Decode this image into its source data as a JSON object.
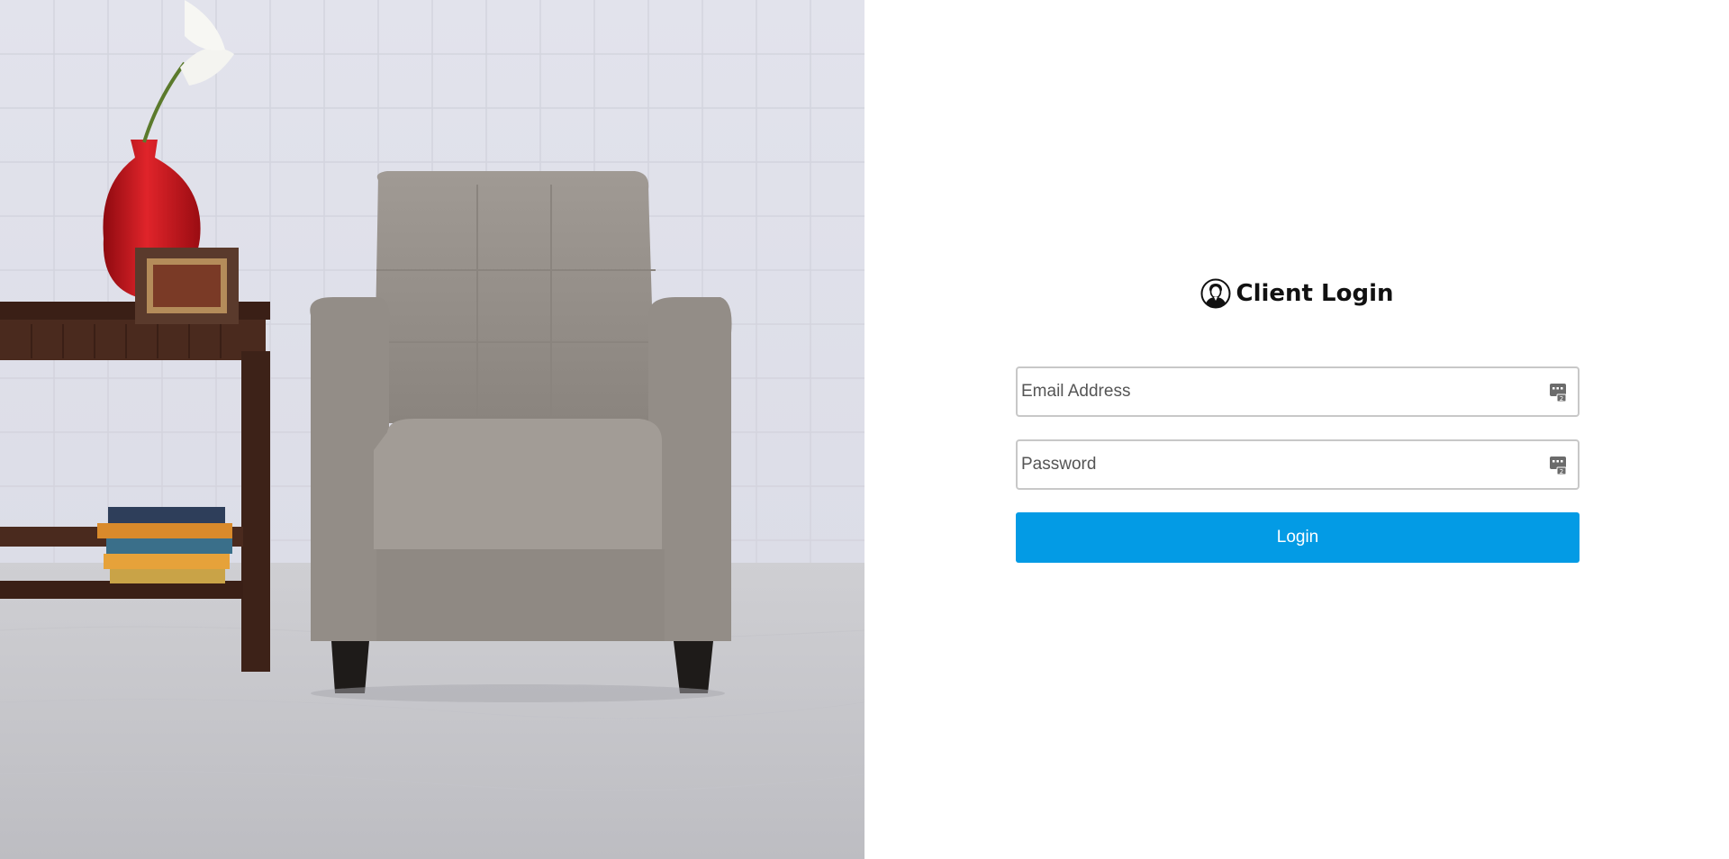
{
  "hero": {
    "icon": "armchair-room-photo"
  },
  "login": {
    "title": "Client Login",
    "title_icon": "user-avatar-icon",
    "email": {
      "placeholder": "Email Address",
      "value": "",
      "icon": "keyboard-autofill-icon"
    },
    "password": {
      "placeholder": "Password",
      "value": "",
      "icon": "keyboard-autofill-icon"
    },
    "submit_label": "Login"
  },
  "colors": {
    "accent": "#039be5",
    "field_border": "#c8c8c8",
    "title_text": "#111111"
  }
}
